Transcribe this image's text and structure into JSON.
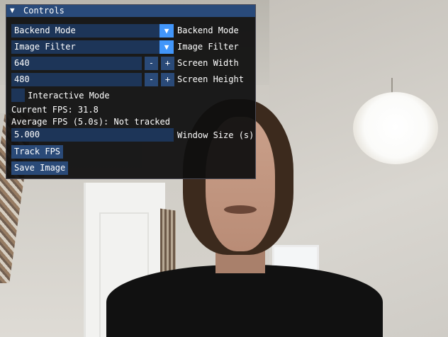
{
  "window": {
    "title": "Controls",
    "collapse_icon": "triangle-down-icon",
    "colors": {
      "title_bg": "#294a7a",
      "frame_bg": "#1d3558",
      "accent": "#4296fa",
      "button": "#2a4a78",
      "window_bg": "#0f0f0f"
    }
  },
  "controls": {
    "backend_combo": {
      "value": "Backend Mode",
      "label": "Backend Mode",
      "arrow": "▼"
    },
    "filter_combo": {
      "value": "Image Filter",
      "label": "Image Filter",
      "arrow": "▼"
    },
    "screen_width": {
      "value": "640",
      "minus": "-",
      "plus": "+",
      "label": "Screen Width"
    },
    "screen_height": {
      "value": "480",
      "minus": "-",
      "plus": "+",
      "label": "Screen Height"
    },
    "interactive_mode": {
      "checked": false,
      "label": "Interactive Mode"
    },
    "current_fps": "Current FPS: 31.8",
    "average_fps": "Average FPS (5.0s): Not tracked",
    "window_size": {
      "value": "5.000",
      "label": "Window Size (s)"
    },
    "track_fps_button": "Track FPS",
    "save_image_button": "Save Image"
  },
  "background": {
    "description_icon": "webcam-feed-image"
  }
}
